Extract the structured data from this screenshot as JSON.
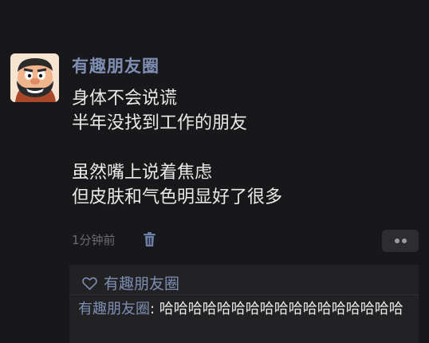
{
  "post": {
    "author": "有趣朋友圈",
    "lines": [
      "身体不会说谎",
      "半年没找到工作的朋友",
      "",
      "虽然嘴上说着焦虑",
      "但皮肤和气色明显好了很多"
    ],
    "time": "1分钟前"
  },
  "likes": {
    "names": "有趣朋友圈"
  },
  "comment": {
    "author": "有趣朋友圈",
    "separator": ": ",
    "text": "哈哈哈哈哈哈哈哈哈哈哈哈哈哈哈哈哈"
  },
  "colors": {
    "background": "#18181a",
    "name_blue": "#7f8fb4",
    "text": "#e9e9ea",
    "meta_gray": "#6c6c70"
  },
  "icons": [
    "avatar-cartoon",
    "trash-icon",
    "more-dots-icon",
    "heart-outline-icon"
  ]
}
